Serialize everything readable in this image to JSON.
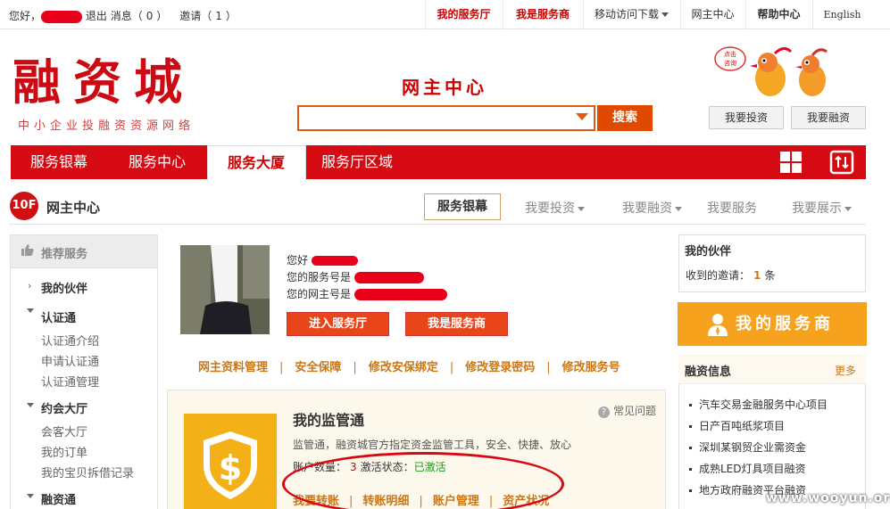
{
  "topbar": {
    "greeting": "您好，",
    "logout": "退出",
    "messages_label": "消息（",
    "messages_count": "0",
    "messages_close": "）",
    "invites_label": "邀请（",
    "invites_count": "1",
    "invites_close": "）",
    "nav": [
      "我的服务厅",
      "我是服务商",
      "移动访问下载",
      "网主中心",
      "帮助中心",
      "English"
    ]
  },
  "header": {
    "logo": "融资城",
    "logo_sub": "中小企业投融资资源网络",
    "center_title": "网主中心",
    "search_placeholder": "",
    "search_button": "搜索",
    "bubble_text": "点击咨询",
    "invest_button": "我要投资",
    "finance_button": "我要融资"
  },
  "mainnav": {
    "items": [
      "服务银幕",
      "服务中心",
      "服务大厦",
      "服务厅区域"
    ],
    "active_index": 2
  },
  "subnav": {
    "floor": "10F",
    "title": "网主中心",
    "selected": "服务银幕",
    "items": [
      "我要投资",
      "我要融资",
      "我要服务",
      "我要展示"
    ]
  },
  "sidebar": {
    "header": "推荐服务",
    "sections": [
      {
        "label": "我的伙伴",
        "children": []
      },
      {
        "label": "认证通",
        "children": [
          "认证通介绍",
          "申请认证通",
          "认证通管理"
        ]
      },
      {
        "label": "约会大厅",
        "children": [
          "会客大厅",
          "我的订单",
          "我的宝贝拆借记录"
        ]
      },
      {
        "label": "融资通",
        "children": []
      }
    ]
  },
  "profile": {
    "hello": "您好",
    "service_no_label": "您的服务号是",
    "owner_no_label": "您的网主号是",
    "enter_hall_button": "进入服务厅",
    "provider_button": "我是服务商",
    "links": [
      "网主资料管理",
      "安全保障",
      "修改安保绑定",
      "修改登录密码",
      "修改服务号"
    ]
  },
  "supervision": {
    "title": "我的监管通",
    "faq": "常见问题",
    "desc": "监管通，融资城官方指定资金监管工具，安全、快捷、放心",
    "account_count_label": "账户数量：",
    "account_count": "3",
    "activation_label": "激活状态：",
    "activation_status": "已激活",
    "actions": [
      "我要转账",
      "转账明细",
      "账户管理",
      "资产状况"
    ],
    "colors": {
      "active": "#1a9a1a",
      "count": "#c00"
    }
  },
  "partner": {
    "title": "我的伙伴",
    "invite_label": "收到的邀请：",
    "invite_count": "1",
    "invite_unit": "条"
  },
  "provider_banner": "我的服务商",
  "news": {
    "title": "融资信息",
    "more": "更多",
    "items": [
      "汽车交易金融服务中心项目",
      "日产百吨纸浆项目",
      "深圳某钢贸企业需资金",
      "成熟LED灯具项目融资",
      "地方政府融资平台融资"
    ]
  },
  "watermark": "www.wooyun.org",
  "colors": {
    "brand_red": "#d60a12",
    "accent_orange": "#f6a21c",
    "link_gold": "#c97718"
  }
}
